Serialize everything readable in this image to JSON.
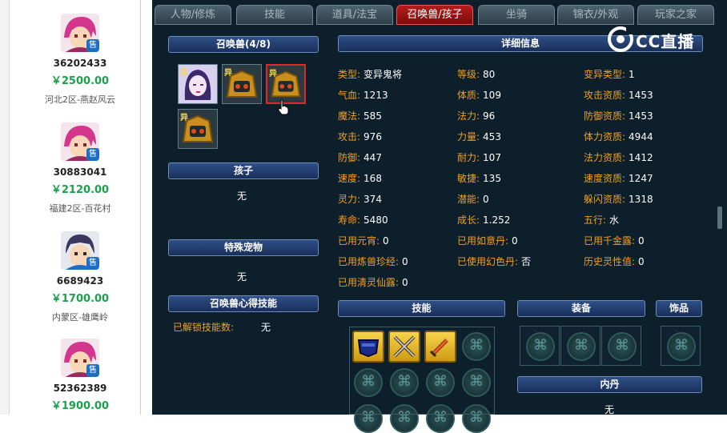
{
  "listings": [
    {
      "id": "36202433",
      "price": "￥2500.00",
      "server": "河北2区-燕赵风云",
      "badge": "售",
      "avatar": "pink-hair"
    },
    {
      "id": "30883041",
      "price": "￥2120.00",
      "server": "福建2区-百花村",
      "badge": "售",
      "avatar": "pink-hair"
    },
    {
      "id": "6689423",
      "price": "￥1700.00",
      "server": "内蒙区-雄鹰岭",
      "badge": "售",
      "avatar": "dark-hair"
    },
    {
      "id": "52362389",
      "price": "￥1900.00",
      "server": "",
      "badge": "售",
      "avatar": "pink-hair"
    }
  ],
  "tabs": [
    "人物/修炼",
    "技能",
    "道具/法宝",
    "召唤兽/孩子",
    "坐骑",
    "锦衣/外观",
    "玩家之家"
  ],
  "active_tab": 3,
  "summon": {
    "header": "召唤兽(4/8)",
    "badge": "异"
  },
  "child": {
    "header": "孩子",
    "value": "无"
  },
  "special_pet": {
    "header": "特殊宠物",
    "value": "无"
  },
  "skill_insight": {
    "header": "召唤兽心得技能",
    "label": "已解锁技能数:",
    "value": "无"
  },
  "details": {
    "header": "详细信息",
    "stats": [
      {
        "k": "类型:",
        "v": "变异鬼将"
      },
      {
        "k": "等级:",
        "v": "80"
      },
      {
        "k": "变异类型:",
        "v": "1"
      },
      {
        "k": "气血:",
        "v": "1213"
      },
      {
        "k": "体质:",
        "v": "109"
      },
      {
        "k": "攻击资质:",
        "v": "1453"
      },
      {
        "k": "魔法:",
        "v": "585"
      },
      {
        "k": "法力:",
        "v": "96"
      },
      {
        "k": "防御资质:",
        "v": "1453"
      },
      {
        "k": "攻击:",
        "v": "976"
      },
      {
        "k": "力量:",
        "v": "453"
      },
      {
        "k": "体力资质:",
        "v": "4944"
      },
      {
        "k": "防御:",
        "v": "447"
      },
      {
        "k": "耐力:",
        "v": "107"
      },
      {
        "k": "法力资质:",
        "v": "1412"
      },
      {
        "k": "速度:",
        "v": "168"
      },
      {
        "k": "敏捷:",
        "v": "135"
      },
      {
        "k": "速度资质:",
        "v": "1247"
      },
      {
        "k": "灵力:",
        "v": "374"
      },
      {
        "k": "潜能:",
        "v": "0"
      },
      {
        "k": "躲闪资质:",
        "v": "1318"
      },
      {
        "k": "寿命:",
        "v": "5480"
      },
      {
        "k": "成长:",
        "v": "1.252"
      },
      {
        "k": "五行:",
        "v": "水"
      },
      {
        "k": "已用元宵:",
        "v": "0"
      },
      {
        "k": "已用如意丹:",
        "v": "0"
      },
      {
        "k": "已用千金露:",
        "v": "0"
      },
      {
        "k": "已用炼兽珍经:",
        "v": "0"
      },
      {
        "k": "已使用幻色丹:",
        "v": "否"
      },
      {
        "k": "历史灵性值:",
        "v": "0"
      },
      {
        "k": "已用清灵仙露:",
        "v": "0"
      }
    ]
  },
  "skills": {
    "header": "技能"
  },
  "equipment": {
    "header": "装备"
  },
  "ornament": {
    "header": "饰品"
  },
  "neidan": {
    "header": "内丹",
    "value": "无"
  },
  "watermark": "CC直播",
  "colors": {
    "active_tab": "#b61c1c",
    "stat_key": "#f0a020",
    "price": "#1ca04a",
    "badge": "#1e6fc4"
  }
}
